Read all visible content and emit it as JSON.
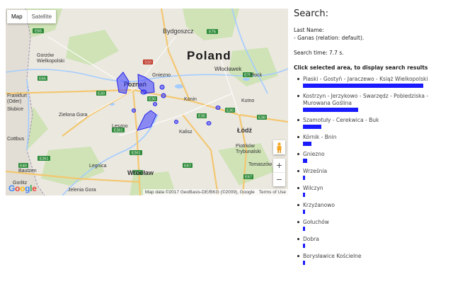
{
  "map": {
    "type_buttons": [
      "Map",
      "Satellite"
    ],
    "country_label": "Poland",
    "cities": [
      {
        "name": "Bydgoszcz"
      },
      {
        "name": "Gorzów\nWielkopolski"
      },
      {
        "name": "Włocławek"
      },
      {
        "name": "Płock"
      },
      {
        "name": "Gniezno"
      },
      {
        "name": "Poznań"
      },
      {
        "name": "Konin"
      },
      {
        "name": "Kutno"
      },
      {
        "name": "Frankfurt\n(Oder)"
      },
      {
        "name": "Słubice"
      },
      {
        "name": "Zielona Gora"
      },
      {
        "name": "Leszno"
      },
      {
        "name": "Łódź"
      },
      {
        "name": "Kalisz"
      },
      {
        "name": "Cottbus"
      },
      {
        "name": "Piotrków\nTrybunalski"
      },
      {
        "name": "Legnica"
      },
      {
        "name": "Wrocław"
      },
      {
        "name": "Bautzen"
      },
      {
        "name": "Jelenia Gora"
      },
      {
        "name": "Gorlitz"
      },
      {
        "name": "Tomaszów"
      }
    ],
    "road_badges": [
      "E65",
      "E261",
      "E75",
      "S10",
      "E30",
      "E30",
      "E30",
      "E30",
      "E30",
      "E261",
      "E67",
      "E67",
      "E67",
      "E75",
      "E261",
      "E65",
      "E40"
    ],
    "attribution": [
      "Map data ©2017 GeoBasis-DE/BKG (©2009), Google",
      "Terms of Use"
    ],
    "google_logo": "Google",
    "zoom_in": "+",
    "zoom_out": "−"
  },
  "panel": {
    "title": "Search:",
    "last_name_label": "Last Name:",
    "last_name_value": "- Ganas (relation: default).",
    "search_time": "Search time: 7.7 s.",
    "instruction": "Click selected area, to display search results",
    "results": [
      {
        "label": "Piaski - Gostyń - Jaraczewo - Książ Wielkopolski",
        "bar": 1.0
      },
      {
        "label": "Kostrzyn - Jerzykowo - Swarzędz - Pobiedziska - Murowana Goślina",
        "bar": 0.46
      },
      {
        "label": "Szamotuły - Cerekwica - Buk",
        "bar": 0.15
      },
      {
        "label": "Kórnik - Bnin",
        "bar": 0.07
      },
      {
        "label": "Gniezno",
        "bar": 0.035
      },
      {
        "label": "Września",
        "bar": 0.012
      },
      {
        "label": "Wilczyn",
        "bar": 0.012
      },
      {
        "label": "Krzyżanowo",
        "bar": 0.012
      },
      {
        "label": "Gołuchów",
        "bar": 0.012
      },
      {
        "label": "Dobra",
        "bar": 0.012
      },
      {
        "label": "Borysławice Kościelne",
        "bar": 0.012
      }
    ]
  },
  "colors": {
    "bar": "#1a1aff",
    "polygon": "#3b3bff",
    "water": "#a3ccff",
    "park": "#c8dfb0",
    "land": "#ebe8e0"
  }
}
